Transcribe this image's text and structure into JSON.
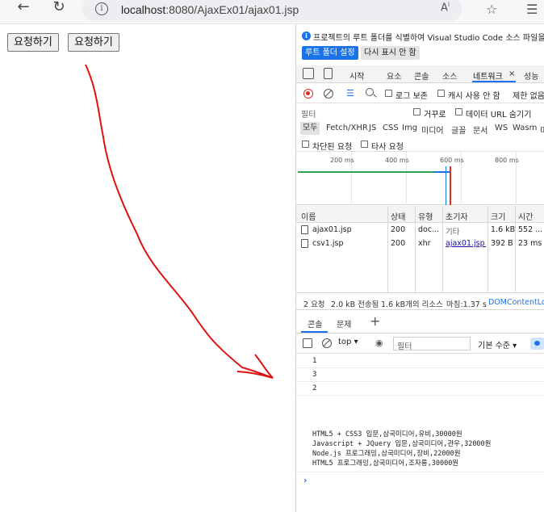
{
  "browser": {
    "url_host": "localhost",
    "url_path": ":8080/AjaxEx01/ajax01.jsp",
    "read_aloud_icon": "Ȃ",
    "favorites_icon": "star-plus"
  },
  "page": {
    "button1_label": "요청하기",
    "button2_label": "요청하기"
  },
  "devtools": {
    "info_text": "프로젝트의 루트 폴더를 식별하여 Visual Studio Code 소스 파일을 열",
    "set_root_button": "루트 폴더 설정",
    "dont_show_button": "다시 표시 안 함",
    "tabs": [
      "시작",
      "요소",
      "콘솔",
      "소스",
      "네트워크",
      "성능"
    ],
    "close_tab_glyph": "×",
    "toolbar": {
      "preserve_log": "로그 보존",
      "disable_cache": "캐시 사용 안 함",
      "throttle": "제한 없음"
    },
    "filter": {
      "placeholder": "필터",
      "invert": "거꾸로",
      "hide_data_urls": "데이터 URL 숨기기"
    },
    "type_filters": [
      "모두",
      "Fetch/XHR",
      "JS",
      "CSS",
      "Img",
      "미디어",
      "글꼴",
      "문서",
      "WS",
      "Wasm",
      "미"
    ],
    "blocked": {
      "blocked_requests": "차단된 요청",
      "third_party": "타사 요청"
    },
    "timeline_ticks": [
      "200 ms",
      "400 ms",
      "600 ms",
      "800 ms"
    ],
    "table": {
      "headers": [
        "이름",
        "상태",
        "유형",
        "초기자",
        "크기",
        "시간"
      ],
      "rows": [
        {
          "name": "ajax01.jsp",
          "status": "200",
          "type": "doc...",
          "initiator": "기타",
          "size": "1.6 kB",
          "time": "552 ..."
        },
        {
          "name": "csv1.jsp",
          "status": "200",
          "type": "xhr",
          "initiator": "ajax01.jsp...",
          "size": "392 B",
          "time": "23 ms"
        }
      ]
    },
    "summary": {
      "requests": "2 요청",
      "transferred": "2.0 kB 전송됨",
      "resources": "1.6 kB개의 리소스",
      "finish": "마침:1.37 s",
      "dom_loaded": "DOMContentLoa"
    },
    "drawer": {
      "console_tab": "콘솔",
      "issues_tab": "문제",
      "add_glyph": "+"
    },
    "console_toolbar": {
      "context": "top",
      "filter_placeholder": "필터",
      "level": "기본 수준"
    },
    "console_output": {
      "lines": [
        "1",
        "3",
        "2"
      ],
      "csv": [
        "HTML5 + CSS3 입문,삼국미디어,유비,30000원",
        "Javascript + JQuery 입문,삼국미디어,관우,32000원",
        "Node.js 프로그래밍,삼국미디어,장비,22000원",
        "HTML5 프로그래밍,삼국미디어,조자룡,30000원"
      ],
      "prompt": "›"
    }
  }
}
